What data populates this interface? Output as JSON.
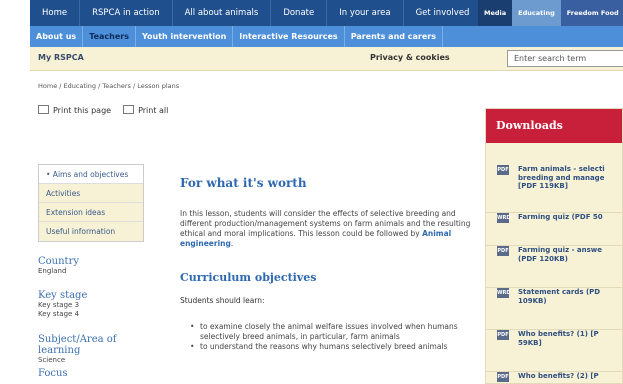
{
  "topnav": {
    "items": [
      "Home",
      "RSPCA in action",
      "All about animals",
      "Donate",
      "In your area",
      "Get involved"
    ],
    "right": [
      "Media",
      "Educating",
      "Freedom Food"
    ]
  },
  "subnav": {
    "items": [
      "About us",
      "Teachers",
      "Youth intervention",
      "Interactive Resources",
      "Parents and carers"
    ]
  },
  "utilbar": {
    "my_rspca": "My RSPCA",
    "privacy": "Privacy & cookies",
    "search_placeholder": "Enter search term"
  },
  "breadcrumb": "Home / Educating / Teachers / Lesson plans",
  "print": {
    "page": "Print this page",
    "all": "Print all"
  },
  "sidemenu": [
    "• Aims and objectives",
    "Activities",
    "Extension ideas",
    "Useful information"
  ],
  "meta": [
    {
      "heading": "Country",
      "values": [
        "England"
      ]
    },
    {
      "heading": "Key stage",
      "values": [
        "Key stage 3",
        "Key stage 4"
      ]
    },
    {
      "heading": "Subject/Area of learning",
      "values": [
        "Science"
      ]
    },
    {
      "heading": "Focus",
      "values": []
    }
  ],
  "main": {
    "title": "For what it's worth",
    "intro_text": "In this lesson, students will consider the effects of selective breeding and different production/management systems on farm animals and the resulting ethical and moral implications. This lesson could be followed by",
    "intro_link": "Animal engineering",
    "intro_end": ".",
    "curriculum_heading": "Curriculum objectives",
    "should_learn": "Students should learn:",
    "bullets": [
      "to examine closely the animal welfare issues involved when humans selectively breed animals, in particular, farm animals",
      "to understand the reasons why humans selectively breed animals"
    ]
  },
  "downloads": {
    "heading": "Downloads",
    "items": [
      {
        "icon": "PDF",
        "label": "Farm animals - selecti\nbreeding and manage\n[PDF 119KB]"
      },
      {
        "icon": "WRD",
        "label": "Farming quiz (PDF 50"
      },
      {
        "icon": "PDF",
        "label": "Farming quiz - answe\n(PDF 120KB)"
      },
      {
        "icon": "WRD",
        "label": "Statement cards (PD\n109KB)"
      },
      {
        "icon": "PDF",
        "label": "Who benefits? (1) [P\n59KB]"
      },
      {
        "icon": "PDF",
        "label": "Who benefits? (2) [P"
      }
    ]
  }
}
